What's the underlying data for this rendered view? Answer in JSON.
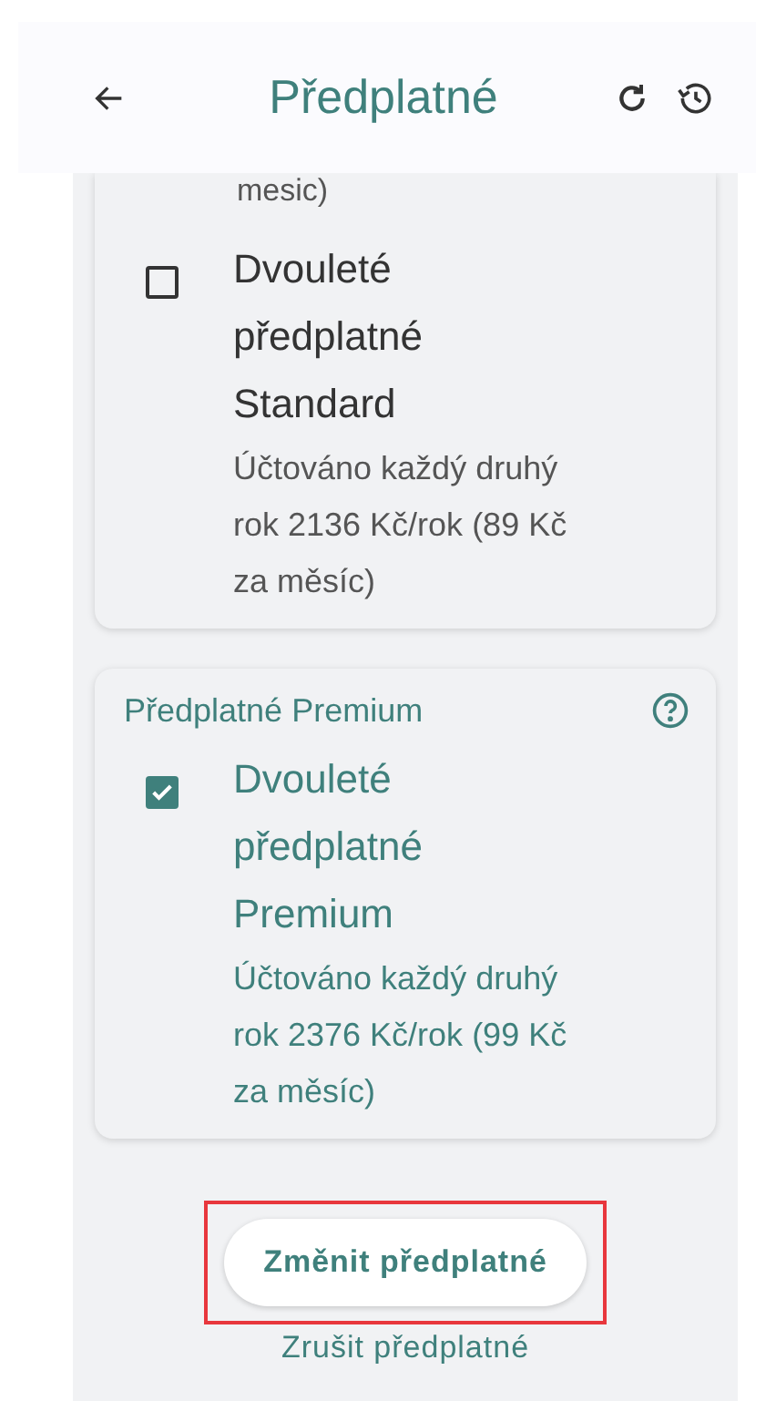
{
  "header": {
    "title": "Předplatné"
  },
  "cards": [
    {
      "lead_text": "mesic)",
      "items": [
        {
          "title": "Dvouleté předplatné Standard",
          "description": "Účtováno každý druhý rok 2136 Kč/rok (89 Kč za měsíc)",
          "checked": false
        }
      ]
    },
    {
      "title": "Předplatné Premium",
      "items": [
        {
          "title": "Dvouleté předplatné Premium",
          "description": "Účtováno každý druhý rok 2376 Kč/rok (99 Kč za měsíc)",
          "checked": true
        }
      ]
    }
  ],
  "primary_button": {
    "label": "Změnit předplatné",
    "highlighted": true
  },
  "cancel_link": "Zrušit předplatné"
}
